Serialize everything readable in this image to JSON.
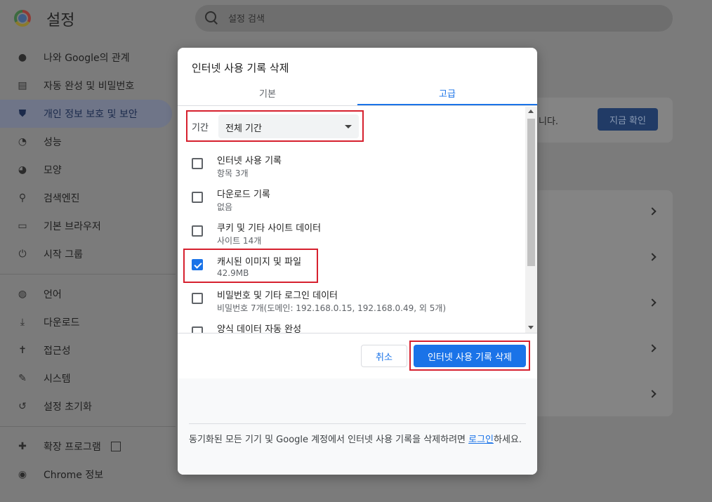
{
  "app": {
    "title": "설정",
    "search_placeholder": "설정 검색"
  },
  "nav": {
    "items": [
      {
        "label": "나와 Google의 관계",
        "icon": "person-icon"
      },
      {
        "label": "자동 완성 및 비밀번호",
        "icon": "clipboard-icon"
      },
      {
        "label": "개인 정보 보호 및 보안",
        "icon": "shield-icon",
        "active": true
      },
      {
        "label": "성능",
        "icon": "speedometer-icon"
      },
      {
        "label": "모양",
        "icon": "palette-icon"
      },
      {
        "label": "검색엔진",
        "icon": "search-icon"
      },
      {
        "label": "기본 브라우저",
        "icon": "browser-icon"
      },
      {
        "label": "시작 그룹",
        "icon": "power-icon"
      }
    ],
    "items2": [
      {
        "label": "언어",
        "icon": "globe-icon"
      },
      {
        "label": "다운로드",
        "icon": "download-icon"
      },
      {
        "label": "접근성",
        "icon": "accessibility-icon"
      },
      {
        "label": "시스템",
        "icon": "wrench-icon"
      },
      {
        "label": "설정 초기화",
        "icon": "reset-icon"
      }
    ],
    "items3": [
      {
        "label": "확장 프로그램",
        "icon": "puzzle-icon"
      },
      {
        "label": "Chrome 정보",
        "icon": "chrome-icon"
      }
    ]
  },
  "background": {
    "card_text": "니다.",
    "check_now": "지금 확인"
  },
  "dialog": {
    "title": "인터넷 사용 기록 삭제",
    "tabs": [
      {
        "label": "기본",
        "active": false
      },
      {
        "label": "고급",
        "active": true
      }
    ],
    "period_label": "기간",
    "period_value": "전체 기간",
    "items": [
      {
        "title": "인터넷 사용 기록",
        "sub": "항목 3개",
        "checked": false
      },
      {
        "title": "다운로드 기록",
        "sub": "없음",
        "checked": false
      },
      {
        "title": "쿠키 및 기타 사이트 데이터",
        "sub": "사이트 14개",
        "checked": false
      },
      {
        "title": "캐시된 이미지 및 파일",
        "sub": "42.9MB",
        "checked": true
      },
      {
        "title": "비밀번호 및 기타 로그인 데이터",
        "sub": "비밀번호 7개(도메인: 192.168.0.15, 192.168.0.49, 외 5개)",
        "checked": false
      },
      {
        "title": "양식 데이터 자동 완성",
        "sub": "",
        "checked": false
      }
    ],
    "cancel_label": "취소",
    "delete_label": "인터넷 사용 기록 삭제",
    "sync_text_before": "동기화된 모든 기기 및 Google 계정에서 인터넷 사용 기록을 삭제하려면 ",
    "sync_link": "로그인",
    "sync_text_after": "하세요."
  }
}
